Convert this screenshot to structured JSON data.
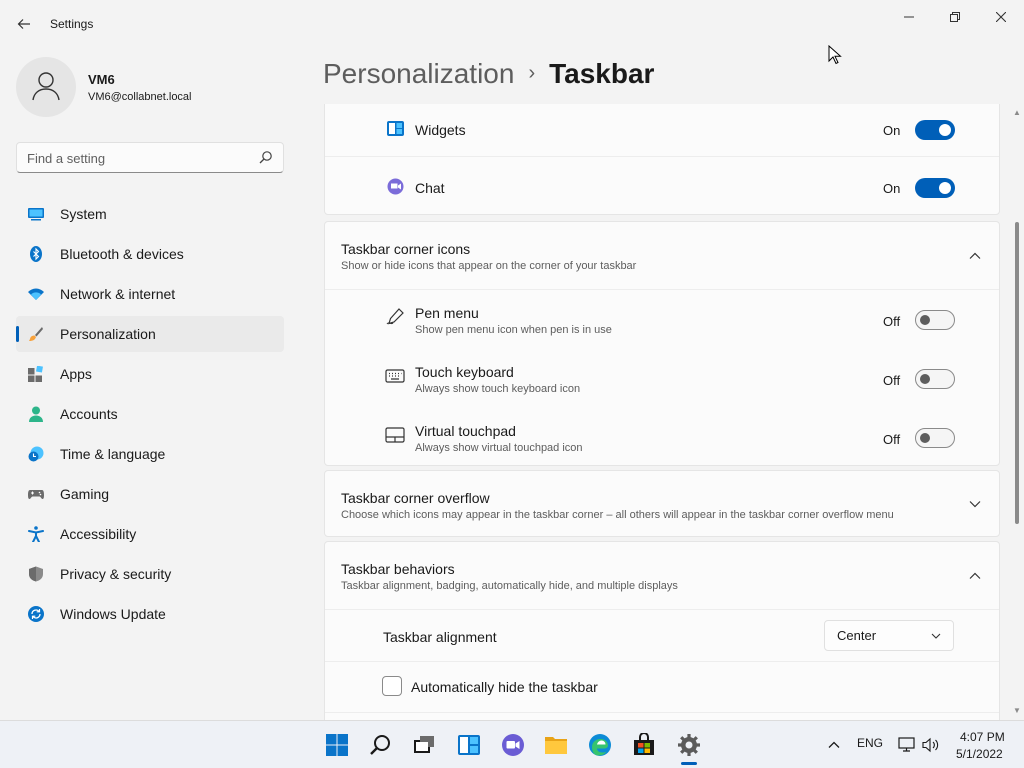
{
  "window": {
    "app_title": "Settings",
    "controls": [
      "minimize",
      "maximize",
      "close"
    ]
  },
  "user": {
    "name": "VM6",
    "email": "VM6@collabnet.local"
  },
  "search": {
    "placeholder": "Find a setting"
  },
  "sidebar": {
    "items": [
      {
        "label": "System",
        "icon": "system-icon"
      },
      {
        "label": "Bluetooth & devices",
        "icon": "bluetooth-icon"
      },
      {
        "label": "Network & internet",
        "icon": "wifi-icon"
      },
      {
        "label": "Personalization",
        "icon": "brush-icon",
        "active": true
      },
      {
        "label": "Apps",
        "icon": "apps-icon"
      },
      {
        "label": "Accounts",
        "icon": "person-icon"
      },
      {
        "label": "Time & language",
        "icon": "clock-globe-icon"
      },
      {
        "label": "Gaming",
        "icon": "controller-icon"
      },
      {
        "label": "Accessibility",
        "icon": "accessibility-icon"
      },
      {
        "label": "Privacy & security",
        "icon": "shield-icon"
      },
      {
        "label": "Windows Update",
        "icon": "update-icon"
      }
    ]
  },
  "breadcrumb": {
    "parent": "Personalization",
    "separator": "›",
    "current": "Taskbar"
  },
  "taskbar_items": {
    "widgets": {
      "label": "Widgets",
      "state": "On",
      "on": true
    },
    "chat": {
      "label": "Chat",
      "state": "On",
      "on": true
    }
  },
  "corner_icons": {
    "title": "Taskbar corner icons",
    "subtitle": "Show or hide icons that appear on the corner of your taskbar",
    "expanded": true,
    "items": [
      {
        "label": "Pen menu",
        "sub": "Show pen menu icon when pen is in use",
        "state": "Off",
        "on": false
      },
      {
        "label": "Touch keyboard",
        "sub": "Always show touch keyboard icon",
        "state": "Off",
        "on": false
      },
      {
        "label": "Virtual touchpad",
        "sub": "Always show virtual touchpad icon",
        "state": "Off",
        "on": false
      }
    ]
  },
  "corner_overflow": {
    "title": "Taskbar corner overflow",
    "subtitle": "Choose which icons may appear in the taskbar corner – all others will appear in the taskbar corner overflow menu",
    "expanded": false
  },
  "behaviors": {
    "title": "Taskbar behaviors",
    "subtitle": "Taskbar alignment, badging, automatically hide, and multiple displays",
    "expanded": true,
    "alignment_label": "Taskbar alignment",
    "alignment_value": "Center",
    "autohide_label": "Automatically hide the taskbar",
    "autohide_checked": false
  },
  "system_taskbar": {
    "apps": [
      "start-icon",
      "search-icon",
      "task-view-icon",
      "widgets-icon",
      "chat-icon",
      "file-explorer-icon",
      "edge-icon",
      "store-icon",
      "settings-icon"
    ],
    "active_app": "settings-icon",
    "language": "ENG",
    "time": "4:07 PM",
    "date": "5/1/2022"
  },
  "colors": {
    "accent": "#005fb8",
    "background": "#f3f3f3",
    "card": "#fbfbfb"
  }
}
